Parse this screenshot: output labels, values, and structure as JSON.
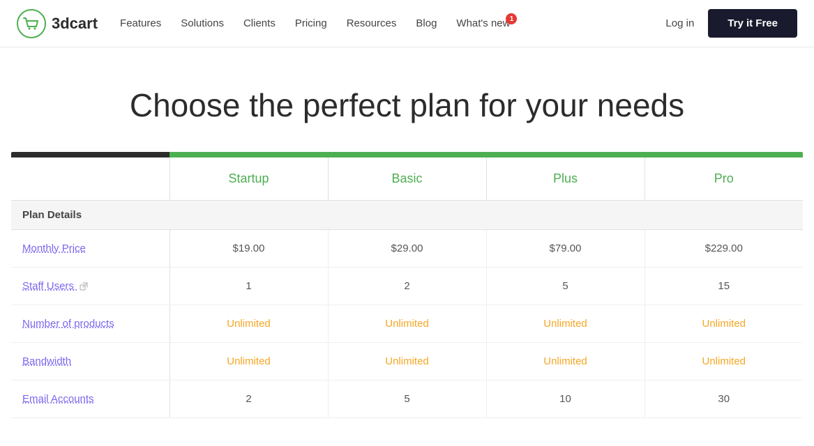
{
  "header": {
    "logo_text": "3dcart",
    "nav_items": [
      {
        "label": "Features",
        "id": "features"
      },
      {
        "label": "Solutions",
        "id": "solutions"
      },
      {
        "label": "Clients",
        "id": "clients"
      },
      {
        "label": "Pricing",
        "id": "pricing"
      },
      {
        "label": "Resources",
        "id": "resources"
      },
      {
        "label": "Blog",
        "id": "blog"
      },
      {
        "label": "What's new",
        "id": "whats-new",
        "badge": "1"
      }
    ],
    "login_label": "Log in",
    "cta_label": "Try it Free"
  },
  "hero": {
    "title": "Choose the perfect plan for your needs"
  },
  "pricing_table": {
    "plans": [
      {
        "id": "startup",
        "label": "Startup"
      },
      {
        "id": "basic",
        "label": "Basic"
      },
      {
        "id": "plus",
        "label": "Plus"
      },
      {
        "id": "pro",
        "label": "Pro"
      }
    ],
    "section_header": "Plan Details",
    "rows": [
      {
        "id": "monthly-price",
        "label": "Monthly Price",
        "type": "link",
        "values": [
          "$19.00",
          "$29.00",
          "$79.00",
          "$229.00"
        ],
        "value_type": "price"
      },
      {
        "id": "staff-users",
        "label": "Staff Users",
        "type": "link",
        "has_icon": true,
        "values": [
          "1",
          "2",
          "5",
          "15"
        ],
        "value_type": "number"
      },
      {
        "id": "number-of-products",
        "label": "Number of products",
        "type": "link",
        "values": [
          "Unlimited",
          "Unlimited",
          "Unlimited",
          "Unlimited"
        ],
        "value_type": "unlimited"
      },
      {
        "id": "bandwidth",
        "label": "Bandwidth",
        "type": "link",
        "values": [
          "Unlimited",
          "Unlimited",
          "Unlimited",
          "Unlimited"
        ],
        "value_type": "unlimited"
      },
      {
        "id": "email-accounts",
        "label": "Email Accounts",
        "type": "link",
        "values": [
          "2",
          "5",
          "10",
          "30"
        ],
        "value_type": "number"
      }
    ]
  }
}
